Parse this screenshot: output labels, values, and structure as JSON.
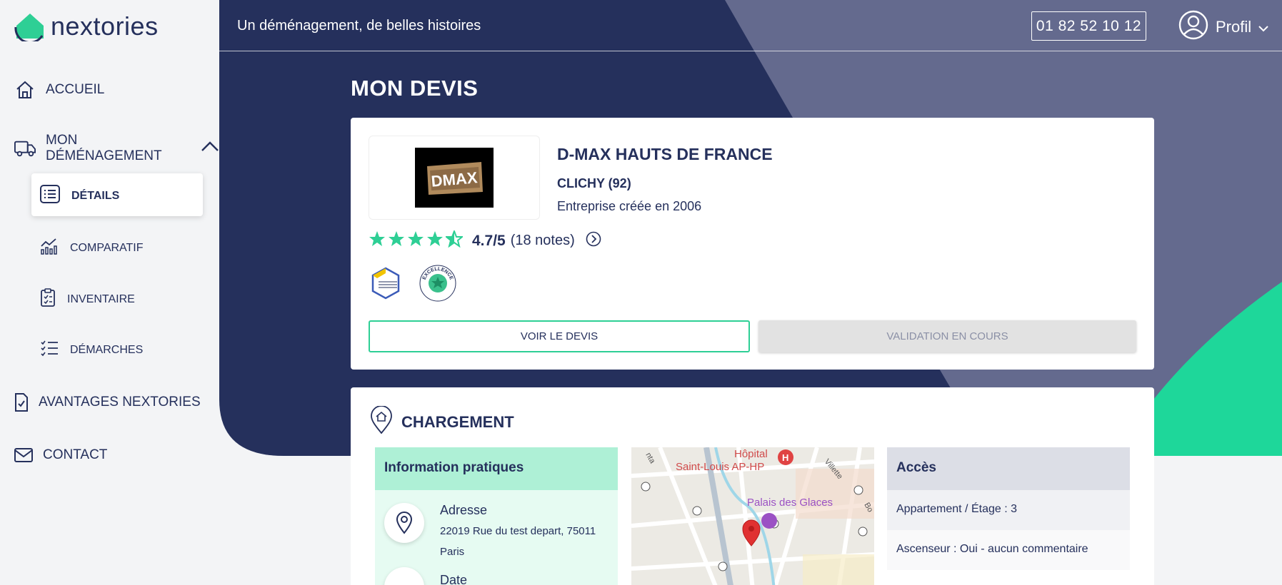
{
  "brand": {
    "name": "nextories",
    "navy": "#25305c",
    "green": "#1ed79a"
  },
  "header": {
    "tagline": "Un déménagement, de belles histoires",
    "phone": "01 82 52 10 12",
    "profile_label": "Profil"
  },
  "sidebar": {
    "items": [
      {
        "label": "ACCUEIL",
        "icon": "home-icon"
      },
      {
        "label": "MON DÉMÉNAGEMENT",
        "icon": "truck-icon"
      },
      {
        "label": "AVANTAGES NEXTORIES",
        "icon": "document-check-icon"
      },
      {
        "label": "CONTACT",
        "icon": "mail-icon"
      }
    ],
    "subitems": [
      {
        "label": "DÉTAILS",
        "icon": "list-icon",
        "active": true
      },
      {
        "label": "COMPARATIF",
        "icon": "chart-icon"
      },
      {
        "label": "INVENTAIRE",
        "icon": "clipboard-icon"
      },
      {
        "label": "DÉMARCHES",
        "icon": "checklist-icon"
      }
    ]
  },
  "page": {
    "title": "MON DEVIS"
  },
  "company": {
    "logo_text": "DMAX",
    "name": "D-MAX HAUTS DE FRANCE",
    "city": "CLICHY (92)",
    "created": "Entreprise créée en 2006",
    "rating_score": "4.7/5",
    "rating_count": "(18 notes)",
    "rating_value": 4.7,
    "rating_max": 5,
    "badges": [
      "chambre-syndicale-badge",
      "excellence-badge"
    ],
    "badge_excellence_text": "EXCELLENCE"
  },
  "actions": {
    "view_quote": "VOIR LE DEVIS",
    "validation": "VALIDATION EN COURS"
  },
  "chargement": {
    "title": "CHARGEMENT",
    "info_title": "Information pratiques",
    "address_label": "Adresse",
    "address_value": "22019 Rue du test depart, 75011 Paris",
    "date_label": "Date",
    "map_labels": {
      "hospital": "Hôpital",
      "hospital2": "Saint-Louis AP-HP",
      "venue": "Palais des Glaces",
      "street": "Villette",
      "street2": "Bo",
      "street3": "nta"
    },
    "access_title": "Accès",
    "access_rows": [
      "Appartement / Étage : 3",
      "Ascenseur : Oui - aucun commentaire"
    ]
  }
}
